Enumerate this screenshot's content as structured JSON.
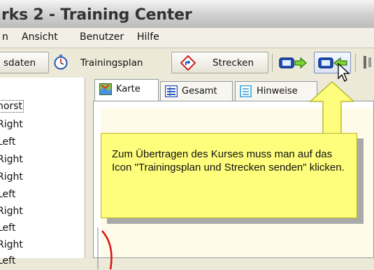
{
  "window": {
    "title": "rks 2 - Training Center"
  },
  "menubar": {
    "items": [
      {
        "label": "n"
      },
      {
        "label": "Ansicht"
      },
      {
        "label": "Benutzer"
      },
      {
        "label": "Hilfe"
      }
    ]
  },
  "toolbar": {
    "buttons": [
      {
        "label": "sdaten",
        "icon": ""
      },
      {
        "label": "Trainingsplan",
        "icon": "stopwatch-icon"
      },
      {
        "label": "Strecken",
        "icon": "route-icon"
      }
    ],
    "icon_buttons": [
      "send-to-device-icon",
      "receive-from-device-icon"
    ]
  },
  "sidebar": {
    "items": [
      "horst",
      "Right",
      "Left",
      "Right",
      "Right",
      "Left",
      "Right",
      "Left",
      "Right",
      "Left"
    ]
  },
  "tabs": [
    {
      "label": "Karte",
      "icon": "map-icon",
      "active": true
    },
    {
      "label": "Gesamt",
      "icon": "table-icon",
      "active": false
    },
    {
      "label": "Hinweise",
      "icon": "notes-icon",
      "active": false
    }
  ],
  "callout": {
    "text": "Zum Übertragen des Kurses muss man auf das Icon \"Trainingsplan und Strecken senden\" klicken.",
    "background": "#fefe7c"
  },
  "colors": {
    "window_bg": "#ece9d8",
    "callout_border": "#b8b832",
    "arrow_fill": "#fefe7c"
  }
}
